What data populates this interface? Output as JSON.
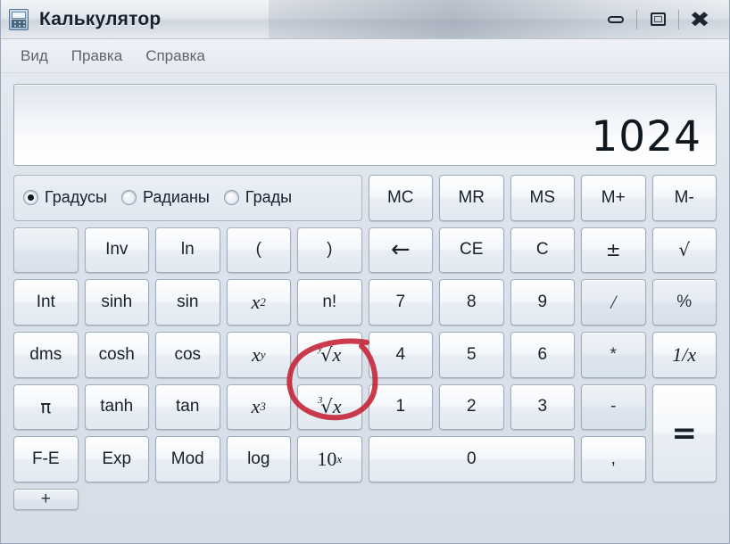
{
  "window": {
    "title": "Калькулятор",
    "icon": "calculator-icon",
    "controls": {
      "minimize": "minimize-icon",
      "restore": "restore-icon",
      "close": "close-icon"
    }
  },
  "menu": {
    "items": [
      {
        "label": "Вид"
      },
      {
        "label": "Правка"
      },
      {
        "label": "Справка"
      }
    ]
  },
  "display": {
    "value": "1024"
  },
  "angle_mode": {
    "options": [
      {
        "label": "Градусы",
        "selected": true
      },
      {
        "label": "Радианы",
        "selected": false
      },
      {
        "label": "Грады",
        "selected": false
      }
    ]
  },
  "memory_keys": [
    {
      "label": "MC",
      "name": "key-memory-clear"
    },
    {
      "label": "MR",
      "name": "key-memory-recall"
    },
    {
      "label": "MS",
      "name": "key-memory-store"
    },
    {
      "label": "M+",
      "name": "key-memory-add"
    },
    {
      "label": "M-",
      "name": "key-memory-subtract"
    }
  ],
  "keys": {
    "row2": [
      {
        "label": "",
        "name": "key-blank",
        "style": "blank"
      },
      {
        "label": "Inv",
        "name": "key-inv"
      },
      {
        "label": "ln",
        "name": "key-ln"
      },
      {
        "label": "(",
        "name": "key-open-paren"
      },
      {
        "label": ")",
        "name": "key-close-paren"
      },
      {
        "label": "←",
        "name": "key-backspace",
        "style": "arrow"
      },
      {
        "label": "CE",
        "name": "key-clear-entry"
      },
      {
        "label": "C",
        "name": "key-clear"
      },
      {
        "label": "±",
        "name": "key-sign",
        "style": "sym"
      },
      {
        "label": "√",
        "name": "key-sqrt",
        "style": "sym"
      }
    ],
    "row3": [
      {
        "label": "Int",
        "name": "key-int"
      },
      {
        "label": "sinh",
        "name": "key-sinh"
      },
      {
        "label": "sin",
        "name": "key-sin"
      },
      {
        "label": "x²",
        "name": "key-x-squared",
        "style": "pow",
        "base": "x",
        "exp": "2"
      },
      {
        "label": "n!",
        "name": "key-factorial"
      },
      {
        "label": "7",
        "name": "key-7"
      },
      {
        "label": "8",
        "name": "key-8"
      },
      {
        "label": "9",
        "name": "key-9"
      },
      {
        "label": "/",
        "name": "key-divide",
        "style": "dim-math"
      },
      {
        "label": "%",
        "name": "key-percent",
        "style": "dim"
      }
    ],
    "row4": [
      {
        "label": "dms",
        "name": "key-dms"
      },
      {
        "label": "cosh",
        "name": "key-cosh"
      },
      {
        "label": "cos",
        "name": "key-cos"
      },
      {
        "label": "xʸ",
        "name": "key-x-power-y",
        "style": "pow",
        "base": "x",
        "exp": "y"
      },
      {
        "label": "ʸ√x",
        "name": "key-y-root-x",
        "style": "root",
        "index": "y",
        "radicand": "x"
      },
      {
        "label": "4",
        "name": "key-4"
      },
      {
        "label": "5",
        "name": "key-5"
      },
      {
        "label": "6",
        "name": "key-6"
      },
      {
        "label": "*",
        "name": "key-multiply",
        "style": "dim"
      },
      {
        "label": "1/x",
        "name": "key-reciprocal",
        "style": "math"
      }
    ],
    "row5": [
      {
        "label": "π",
        "name": "key-pi",
        "style": "sym"
      },
      {
        "label": "tanh",
        "name": "key-tanh"
      },
      {
        "label": "tan",
        "name": "key-tan"
      },
      {
        "label": "x³",
        "name": "key-x-cubed",
        "style": "pow",
        "base": "x",
        "exp": "3"
      },
      {
        "label": "³√x",
        "name": "key-cube-root",
        "style": "root",
        "index": "3",
        "radicand": "x"
      },
      {
        "label": "1",
        "name": "key-1"
      },
      {
        "label": "2",
        "name": "key-2"
      },
      {
        "label": "3",
        "name": "key-3"
      },
      {
        "label": "-",
        "name": "key-subtract",
        "style": "dim"
      }
    ],
    "row6": [
      {
        "label": "F-E",
        "name": "key-float-exp"
      },
      {
        "label": "Exp",
        "name": "key-exp"
      },
      {
        "label": "Mod",
        "name": "key-mod"
      },
      {
        "label": "log",
        "name": "key-log"
      },
      {
        "label": "10ˣ",
        "name": "key-ten-power-x",
        "style": "pow",
        "base": "10",
        "exp": "x"
      },
      {
        "label": "0",
        "name": "key-0",
        "wide": true
      },
      {
        "label": ",",
        "name": "key-decimal-separator"
      },
      {
        "label": "+",
        "name": "key-add",
        "style": "dim"
      }
    ],
    "equals": {
      "label": "=",
      "name": "key-equals"
    }
  },
  "annotation": {
    "shape": "hand-drawn-circle",
    "color": "#c42033",
    "targets": "key-y-root-x"
  }
}
